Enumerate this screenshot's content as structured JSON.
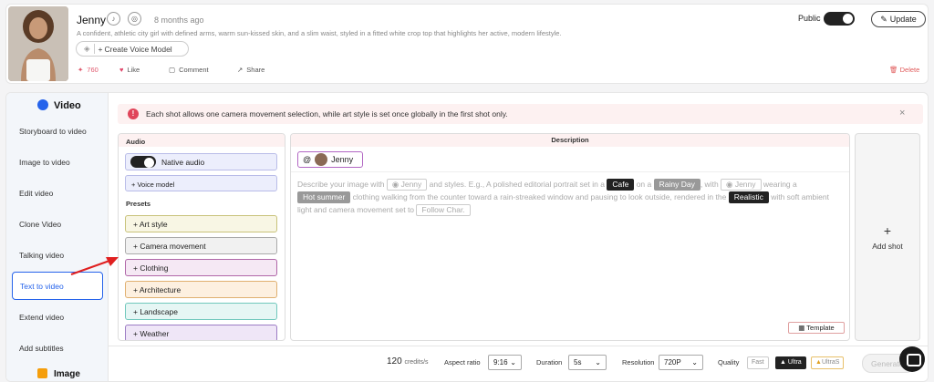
{
  "profile": {
    "name": "Jenny",
    "time_ago": "8 months ago",
    "description": "A confident, athletic city girl with defined arms, warm sun-kissed skin, and a slim waist, styled in a fitted white crop top that highlights her active, modern lifestyle.",
    "create_voice_label": "Create Voice Model",
    "likes_count": "760",
    "like_label": "Like",
    "comment_label": "Comment",
    "share_label": "Share",
    "public_label": "Public",
    "public_on": true,
    "update_label": "Update",
    "delete_label": "Delete"
  },
  "sidebar": {
    "video_heading": "Video",
    "items": [
      "Storyboard to video",
      "Image to video",
      "Edit video",
      "Clone Video",
      "Talking video",
      "Text to video",
      "Extend video",
      "Add subtitles"
    ],
    "active_item": "Text to video",
    "image_heading": "Image"
  },
  "alert": {
    "text": "Each shot allows one camera movement selection, while art style is set once globally in the first shot only."
  },
  "audio": {
    "title": "Audio",
    "native_label": "Native audio",
    "native_on": true,
    "voice_model_label": "Voice model",
    "presets_title": "Presets",
    "presets": [
      {
        "label": "Art style",
        "bg": "#f8f6e4",
        "border": "#c8c27a"
      },
      {
        "label": "Camera movement",
        "bg": "#f1f1f1",
        "border": "#aaaaaa"
      },
      {
        "label": "Clothing",
        "bg": "#f5e8f4",
        "border": "#b066a8"
      },
      {
        "label": "Architecture",
        "bg": "#fdf0e0",
        "border": "#e0b070"
      },
      {
        "label": "Landscape",
        "bg": "#e6f6f4",
        "border": "#70c8bc"
      },
      {
        "label": "Weather",
        "bg": "#efe6f7",
        "border": "#9c7cc4"
      }
    ]
  },
  "description": {
    "title": "Description",
    "tag_at": "@",
    "tag_name": "Jenny",
    "p1": "Describe your image with",
    "c_jenny": "Jenny",
    "p2": "and styles. E.g., A polished editorial portrait set in a",
    "c_cafe": "Cafe",
    "p3": "on a",
    "c_rainy": "Rainy Day",
    "p4": ", with",
    "p5": "wearing a",
    "c_hot": "Hot summer",
    "p6": "clothing walking from the counter toward a rain-streaked window and pausing to look outside, rendered in the",
    "c_realistic": "Realistic",
    "p7": "with soft ambient light and camera movement set to",
    "c_follow": "Follow Char.",
    "template_label": "Template"
  },
  "add_shot": {
    "plus": "+",
    "label": "Add shot"
  },
  "footer": {
    "credits_num": "120",
    "credits_unit": "credits/s",
    "aspect_label": "Aspect ratio",
    "aspect_value": "9:16",
    "duration_label": "Duration",
    "duration_value": "5s",
    "resolution_label": "Resolution",
    "resolution_value": "720P",
    "quality_label": "Quality",
    "quality_options": [
      "Fast",
      "Ultra",
      "UltraS"
    ],
    "quality_selected": "Ultra",
    "generate_label": "Generate"
  }
}
